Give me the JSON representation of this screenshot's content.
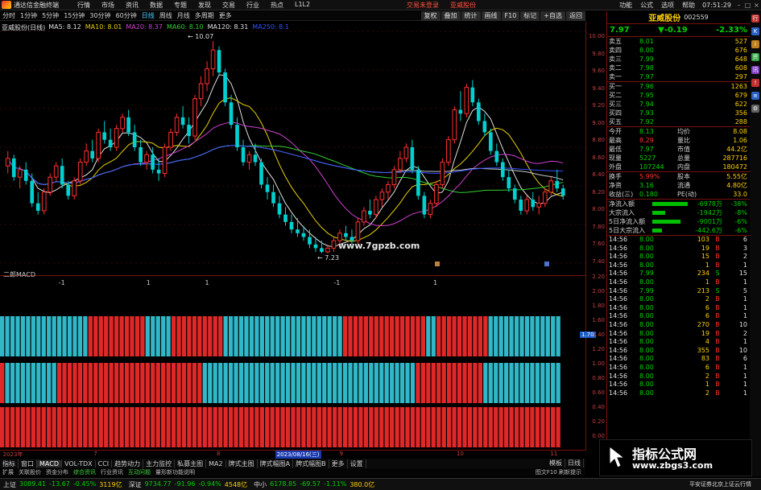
{
  "window": {
    "app_title": "通达信金融终端",
    "menu": [
      "行情",
      "市场",
      "资讯",
      "数据",
      "专题",
      "发现",
      "交易",
      "行业",
      "热点",
      "L1L2"
    ],
    "center_links": [
      "交易未登录",
      "亚威股份"
    ],
    "right_menu": [
      "功能",
      "公式",
      "选项",
      "帮助"
    ],
    "clock": "07:51:29"
  },
  "toolbar": {
    "periods": [
      "分时",
      "1分钟",
      "5分钟",
      "15分钟",
      "30分钟",
      "60分钟",
      "日线",
      "周线",
      "月线",
      "多周期",
      "更多"
    ],
    "active_period": "日线",
    "right_tools": [
      "复权",
      "叠加",
      "统计",
      "画线",
      "F10",
      "标记",
      "+自选",
      "返回"
    ]
  },
  "price_chart": {
    "stock_label": "亚威股份(日线)",
    "ma_legend": [
      {
        "label": "MA5: 8.12",
        "color": "#e0e0e0"
      },
      {
        "label": "MA10: 8.01",
        "color": "#e8d000"
      },
      {
        "label": "MA20: 8.37",
        "color": "#d040d0"
      },
      {
        "label": "MA60: 8.10",
        "color": "#30d030"
      },
      {
        "label": "MA120: 8.31",
        "color": "#e0e0e0"
      },
      {
        "label": "MA250: 8.1",
        "color": "#3050ff"
      }
    ],
    "high_label": "10.07",
    "low_label": "7.23",
    "watermark": "www.7gpzb.com",
    "y_ticks": [
      "10.00",
      "9.80",
      "9.60",
      "9.40",
      "9.20",
      "9.00",
      "8.80",
      "8.60",
      "8.40",
      "8.20",
      "8.00",
      "7.80",
      "7.60",
      "7.40"
    ]
  },
  "chart_data": {
    "type": "candlestick",
    "y_range": [
      7.1,
      10.2
    ],
    "candles": [
      [
        8.4,
        8.6,
        8.3,
        8.5
      ],
      [
        8.5,
        8.55,
        8.2,
        8.25
      ],
      [
        8.25,
        8.4,
        8.1,
        8.35
      ],
      [
        8.35,
        8.45,
        8.15,
        8.2
      ],
      [
        8.2,
        8.3,
        7.85,
        7.9
      ],
      [
        7.9,
        8.05,
        7.75,
        7.8
      ],
      [
        7.8,
        8.1,
        7.75,
        8.05
      ],
      [
        8.05,
        8.3,
        8.0,
        8.25
      ],
      [
        8.25,
        8.45,
        8.2,
        8.4
      ],
      [
        8.4,
        8.5,
        8.1,
        8.15
      ],
      [
        8.15,
        8.2,
        7.95,
        8.0
      ],
      [
        8.0,
        8.25,
        7.95,
        8.2
      ],
      [
        8.2,
        8.5,
        8.15,
        8.45
      ],
      [
        8.45,
        8.7,
        8.4,
        8.6
      ],
      [
        8.6,
        8.75,
        8.45,
        8.5
      ],
      [
        8.5,
        8.9,
        8.45,
        8.85
      ],
      [
        8.85,
        9.0,
        8.7,
        8.75
      ],
      [
        8.75,
        8.9,
        8.6,
        8.65
      ],
      [
        8.65,
        8.95,
        8.6,
        8.9
      ],
      [
        8.9,
        9.1,
        8.85,
        9.05
      ],
      [
        9.05,
        9.15,
        8.8,
        8.85
      ],
      [
        8.85,
        8.95,
        8.6,
        8.65
      ],
      [
        8.65,
        8.75,
        8.4,
        8.45
      ],
      [
        8.45,
        8.6,
        8.35,
        8.55
      ],
      [
        8.55,
        8.65,
        8.3,
        8.35
      ],
      [
        8.35,
        8.5,
        8.2,
        8.3
      ],
      [
        8.3,
        8.7,
        8.25,
        8.65
      ],
      [
        8.65,
        8.9,
        8.6,
        8.85
      ],
      [
        8.85,
        9.1,
        8.8,
        9.05
      ],
      [
        9.05,
        9.2,
        8.9,
        8.95
      ],
      [
        8.95,
        9.05,
        8.7,
        8.8
      ],
      [
        8.8,
        9.35,
        8.75,
        9.3
      ],
      [
        9.3,
        9.6,
        9.2,
        9.5
      ],
      [
        9.5,
        9.8,
        9.4,
        9.7
      ],
      [
        9.7,
        10.07,
        9.6,
        9.95
      ],
      [
        9.95,
        10.0,
        9.6,
        9.65
      ],
      [
        9.65,
        9.7,
        9.2,
        9.25
      ],
      [
        9.25,
        9.35,
        8.9,
        8.95
      ],
      [
        8.95,
        9.05,
        8.6,
        8.65
      ],
      [
        8.65,
        8.75,
        8.4,
        8.45
      ],
      [
        8.45,
        8.6,
        8.35,
        8.55
      ],
      [
        8.55,
        8.7,
        8.4,
        8.45
      ],
      [
        8.45,
        8.5,
        8.1,
        8.15
      ],
      [
        8.15,
        8.25,
        7.95,
        8.05
      ],
      [
        8.05,
        8.15,
        7.85,
        7.9
      ],
      [
        7.9,
        8.0,
        7.7,
        7.75
      ],
      [
        7.75,
        7.85,
        7.6,
        7.65
      ],
      [
        7.65,
        7.75,
        7.5,
        7.55
      ],
      [
        7.55,
        7.7,
        7.45,
        7.5
      ],
      [
        7.5,
        7.6,
        7.4,
        7.45
      ],
      [
        7.45,
        7.55,
        7.3,
        7.35
      ],
      [
        7.35,
        7.45,
        7.25,
        7.3
      ],
      [
        7.3,
        7.4,
        7.23,
        7.25
      ],
      [
        7.25,
        7.35,
        7.23,
        7.3
      ],
      [
        7.3,
        7.45,
        7.25,
        7.4
      ],
      [
        7.4,
        7.55,
        7.35,
        7.5
      ],
      [
        7.5,
        7.6,
        7.4,
        7.45
      ],
      [
        7.45,
        7.55,
        7.35,
        7.4
      ],
      [
        7.4,
        7.7,
        7.35,
        7.65
      ],
      [
        7.65,
        7.85,
        7.6,
        7.8
      ],
      [
        7.8,
        7.95,
        7.7,
        7.75
      ],
      [
        7.75,
        8.0,
        7.7,
        7.95
      ],
      [
        7.95,
        8.1,
        7.85,
        8.05
      ],
      [
        8.05,
        8.2,
        7.95,
        8.15
      ],
      [
        8.15,
        8.4,
        8.1,
        8.35
      ],
      [
        8.35,
        8.6,
        8.3,
        8.5
      ],
      [
        8.5,
        8.7,
        8.45,
        8.65
      ],
      [
        8.65,
        8.75,
        8.3,
        8.35
      ],
      [
        8.35,
        8.4,
        7.95,
        8.0
      ],
      [
        8.0,
        8.05,
        7.7,
        7.75
      ],
      [
        7.75,
        7.95,
        7.7,
        7.9
      ],
      [
        7.9,
        8.2,
        7.85,
        8.15
      ],
      [
        8.15,
        8.5,
        8.1,
        8.45
      ],
      [
        8.45,
        8.8,
        8.4,
        8.75
      ],
      [
        8.75,
        9.2,
        8.7,
        9.15
      ],
      [
        9.15,
        9.4,
        9.0,
        9.1
      ],
      [
        9.1,
        9.5,
        9.05,
        9.45
      ],
      [
        9.45,
        9.55,
        9.2,
        9.25
      ],
      [
        9.25,
        9.3,
        8.95,
        9.0
      ],
      [
        9.0,
        9.1,
        8.8,
        8.85
      ],
      [
        8.85,
        8.9,
        8.55,
        8.6
      ],
      [
        8.6,
        8.7,
        8.4,
        8.45
      ],
      [
        8.45,
        8.5,
        8.2,
        8.25
      ],
      [
        8.25,
        8.35,
        8.05,
        8.1
      ],
      [
        8.1,
        8.15,
        7.9,
        7.95
      ],
      [
        7.95,
        8.0,
        7.75,
        7.8
      ],
      [
        7.8,
        8.0,
        7.75,
        7.95
      ],
      [
        7.95,
        8.05,
        7.8,
        7.85
      ],
      [
        7.85,
        8.0,
        7.75,
        7.9
      ],
      [
        7.9,
        8.1,
        7.85,
        8.05
      ],
      [
        8.05,
        8.25,
        8.0,
        8.2
      ],
      [
        8.2,
        8.35,
        8.05,
        8.1
      ],
      [
        8.1,
        8.15,
        7.95,
        8.0
      ]
    ]
  },
  "indicator": {
    "title": "二郎MACD",
    "marks": [
      {
        "label": "-1",
        "pos": 0.1
      },
      {
        "label": "1",
        "pos": 0.25
      },
      {
        "label": "1",
        "pos": 0.35
      },
      {
        "label": "-1",
        "pos": 0.57
      },
      {
        "label": "1",
        "pos": 0.74
      }
    ],
    "y_ticks": [
      "2.20",
      "2.00",
      "1.80",
      "1.60",
      "1.40",
      "1.20",
      "1.00",
      "0.80",
      "0.60",
      "0.40",
      "0.20",
      "0.00"
    ],
    "highlight_tick": "1.70",
    "rows": [
      {
        "color_runs": [
          [
            "c",
            17
          ],
          [
            "r",
            11
          ],
          [
            "c",
            5
          ],
          [
            "r",
            10
          ],
          [
            "c",
            23
          ],
          [
            "r",
            16
          ],
          [
            "c",
            2
          ],
          [
            "r",
            10
          ],
          [
            "c",
            14
          ]
        ]
      },
      {
        "color_runs": [
          [
            "r",
            1
          ],
          [
            "c",
            10
          ],
          [
            "r",
            28
          ],
          [
            "c",
            41
          ],
          [
            "r",
            13
          ],
          [
            "c",
            15
          ]
        ]
      },
      {
        "color_runs": [
          [
            "r",
            108
          ]
        ]
      }
    ]
  },
  "date_axis": {
    "labels": [
      {
        "text": "2023年",
        "pos": 0.005
      },
      {
        "text": "7",
        "pos": 0.16
      },
      {
        "text": "8",
        "pos": 0.37
      },
      {
        "text": "2023/08/16(三)",
        "pos": 0.47,
        "highlight": true
      },
      {
        "text": "9",
        "pos": 0.58
      },
      {
        "text": "10",
        "pos": 0.78
      },
      {
        "text": "11",
        "pos": 0.94
      }
    ]
  },
  "indicator_tabs": {
    "items": [
      "指标",
      "窗口",
      "MACD",
      "VOL-TDX",
      "CCI",
      "趋势动力",
      "主力监控",
      "私募主图",
      "MA2",
      "牌式主图",
      "牌式幅图A",
      "牌式幅图B",
      "更多",
      "设置"
    ],
    "active": "MACD",
    "right_items": [
      "模板",
      "日线"
    ]
  },
  "links_row": {
    "items": [
      "扩展",
      "关联股价",
      "资金分布",
      "综合资讯",
      "行业资讯",
      "互动问题",
      "量形新功能说明"
    ],
    "green": [
      "综合资讯",
      "互动问题"
    ],
    "right_text": "图文F10 刷新提示"
  },
  "quote": {
    "name": "亚威股份",
    "code": "002559",
    "price": "7.97",
    "change": "▼-0.19",
    "pct": "-2.33%",
    "asks": [
      {
        "label": "卖五",
        "price": "8.01",
        "vol": "527"
      },
      {
        "label": "卖四",
        "price": "8.00",
        "vol": "676"
      },
      {
        "label": "卖三",
        "price": "7.99",
        "vol": "648"
      },
      {
        "label": "卖二",
        "price": "7.98",
        "vol": "608"
      },
      {
        "label": "卖一",
        "price": "7.97",
        "vol": "297"
      }
    ],
    "bids": [
      {
        "label": "买一",
        "price": "7.96",
        "vol": "1263"
      },
      {
        "label": "买二",
        "price": "7.95",
        "vol": "679"
      },
      {
        "label": "买三",
        "price": "7.94",
        "vol": "622"
      },
      {
        "label": "买四",
        "price": "7.93",
        "vol": "356"
      },
      {
        "label": "买五",
        "price": "7.92",
        "vol": "288"
      }
    ],
    "stats": [
      [
        "今开",
        "8.13",
        "均价",
        "8.08"
      ],
      [
        "最高",
        "8.29",
        "量比",
        "1.06"
      ],
      [
        "最低",
        "7.97",
        "市值",
        "44.2亿"
      ],
      [
        "现量",
        "5227",
        "总量",
        "287716"
      ],
      [
        "外盘",
        "107244",
        "内盘",
        "180472"
      ]
    ],
    "stats2": [
      [
        "换手",
        "5.99%",
        "股本",
        "5.55亿"
      ],
      [
        "净资",
        "3.16",
        "流通",
        "4.80亿"
      ],
      [
        "收益(三)",
        "0.180",
        "PE(动)",
        "33.0"
      ]
    ],
    "flows": [
      {
        "label": "净流入额",
        "value": "-6978万",
        "pct": "-38%",
        "bar": 0.95
      },
      {
        "label": "大宗流入",
        "value": "-1942万",
        "pct": "-8%",
        "bar": 0.35
      },
      {
        "label": "5日净流入额",
        "value": "-9001万",
        "pct": "-6%",
        "bar": 0.75
      },
      {
        "label": "5日大宗流入",
        "value": "-442.6万",
        "pct": "-6%",
        "bar": 0.25
      }
    ],
    "ticks": [
      [
        "14:56",
        "8.00",
        "103",
        "B",
        "6"
      ],
      [
        "14:56",
        "8.00",
        "19",
        "B",
        "3"
      ],
      [
        "14:56",
        "8.00",
        "15",
        "B",
        "2"
      ],
      [
        "14:56",
        "8.00",
        "1",
        "B",
        "1"
      ],
      [
        "14:56",
        "7.99",
        "234",
        "S",
        "15"
      ],
      [
        "14:56",
        "8.00",
        "1",
        "B",
        "1"
      ],
      [
        "14:56",
        "7.99",
        "213",
        "S",
        "5"
      ],
      [
        "14:56",
        "8.00",
        "2",
        "B",
        "1"
      ],
      [
        "14:56",
        "8.00",
        "6",
        "B",
        "1"
      ],
      [
        "14:56",
        "8.00",
        "6",
        "B",
        "1"
      ],
      [
        "14:56",
        "8.00",
        "270",
        "B",
        "10"
      ],
      [
        "14:56",
        "8.00",
        "19",
        "B",
        "2"
      ],
      [
        "14:56",
        "8.00",
        "4",
        "B",
        "1"
      ],
      [
        "14:56",
        "8.00",
        "355",
        "B",
        "10"
      ],
      [
        "14:56",
        "8.00",
        "83",
        "B",
        "6"
      ],
      [
        "14:56",
        "8.00",
        "6",
        "B",
        "1"
      ],
      [
        "14:56",
        "8.00",
        "2",
        "B",
        "1"
      ],
      [
        "14:56",
        "8.00",
        "1",
        "B",
        "1"
      ],
      [
        "14:56",
        "8.00",
        "2",
        "B",
        "1"
      ]
    ]
  },
  "statusbar": {
    "indices": [
      {
        "name": "上证",
        "value": "3089.41",
        "chg": "-13.67",
        "pct": "-0.45%",
        "amt": "3119亿"
      },
      {
        "name": "深证",
        "value": "9734.77",
        "chg": "-91.96",
        "pct": "-0.94%",
        "amt": "4548亿"
      },
      {
        "name": "中小",
        "value": "6178.85",
        "chg": "-69.57",
        "pct": "-1.11%",
        "amt": "380.0亿"
      }
    ],
    "broker": "平安证券北京上证云行情"
  },
  "overlay": {
    "title": "指标公式网",
    "url": "www.zbgs3.com"
  },
  "colors": {
    "up": "#ff3030",
    "down": "#00d0d0",
    "bar_red": "#e02828",
    "bar_cyan": "#30b8c8",
    "grid": "#7a1010"
  }
}
